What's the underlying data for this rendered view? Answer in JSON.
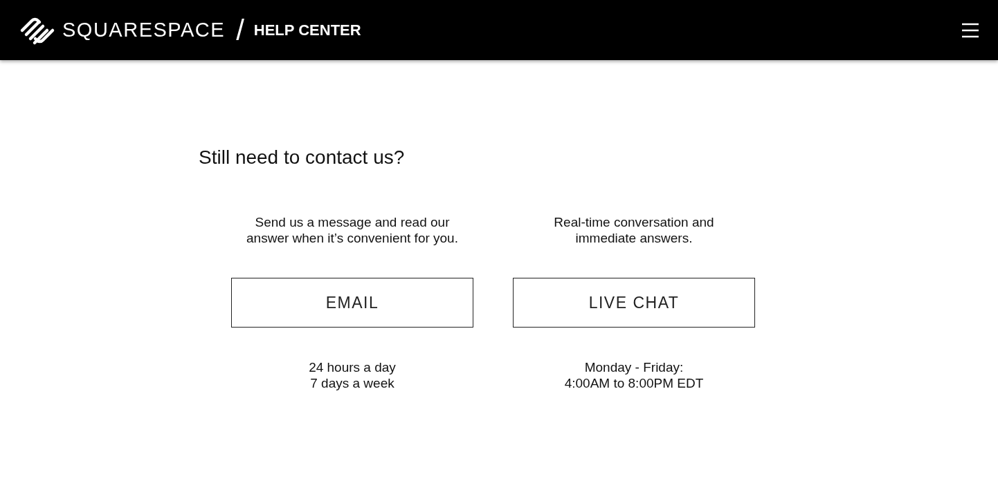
{
  "header": {
    "brand": "SQUARESPACE",
    "separator": "/",
    "section": "HELP CENTER"
  },
  "heading": "Still need to contact us?",
  "options": [
    {
      "description": "Send us a message and read our\nanswer when it’s convenient for you.",
      "button": "EMAIL",
      "hours": "24 hours a day\n7 days a week"
    },
    {
      "description": "Real-time conversation and\nimmediate answers.",
      "button": "LIVE CHAT",
      "hours": "Monday - Friday:\n4:00AM to 8:00PM EDT"
    }
  ]
}
